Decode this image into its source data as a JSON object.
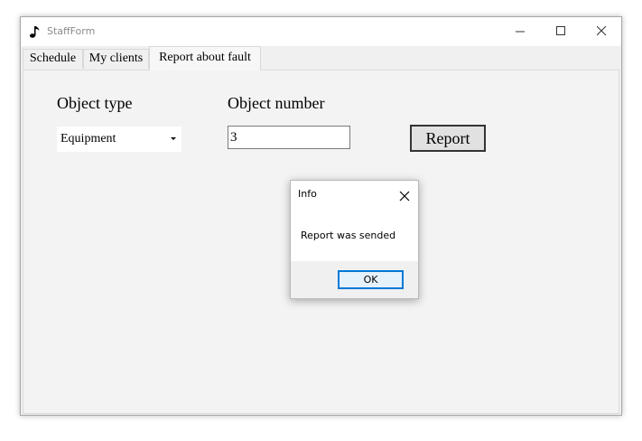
{
  "window": {
    "title": "StaffForm",
    "app_icon": "music-note-icon"
  },
  "titlebar_buttons": [
    "minimize-icon",
    "maximize-icon",
    "close-icon"
  ],
  "tabs": [
    {
      "label": "Schedule",
      "active": false
    },
    {
      "label": "My clients",
      "active": false
    },
    {
      "label": "Report about fault",
      "active": true
    }
  ],
  "form": {
    "object_type_label": "Object type",
    "object_type_value": "Equipment",
    "object_number_label": "Object number",
    "object_number_value": "3",
    "report_button": "Report"
  },
  "dialog": {
    "title": "Info",
    "message": "Report was sended",
    "ok_label": "OK"
  },
  "colors": {
    "accent": "#0078d7",
    "dialog_button_bg": "#e5f1fb"
  }
}
